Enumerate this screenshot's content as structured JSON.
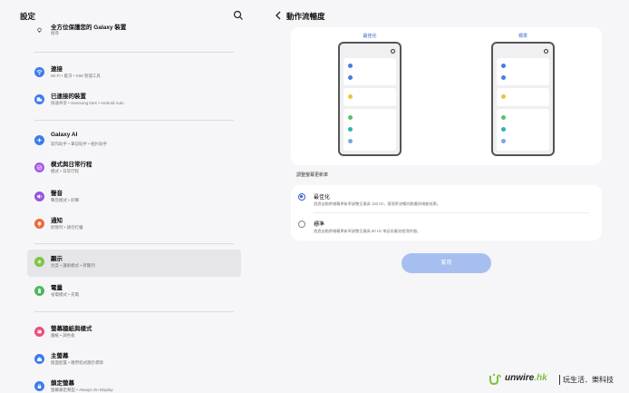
{
  "left_pane": {
    "title": "設定",
    "items": [
      {
        "key": "find-device",
        "title": "全方位保護您的 Galaxy 裝置",
        "subtitle": "搜尋",
        "icon": "lightbulb-icon",
        "color": ""
      },
      {
        "key": "connections",
        "title": "連接",
        "subtitle": "Wi-Fi • 藍牙 • SIM 管理工具",
        "icon": "wifi-icon",
        "color": "#3d7cf0"
      },
      {
        "key": "connected-devices",
        "title": "已連接的裝置",
        "subtitle": "快速共享 • Samsung DeX • Android Auto",
        "icon": "devices-icon",
        "color": "#3d7cf0"
      },
      {
        "key": "galaxy-ai",
        "title": "Galaxy AI",
        "subtitle": "寫作助手 • 筆記助手 • 相片助手",
        "icon": "sparkle-icon",
        "color": "#3d7cf0"
      },
      {
        "key": "modes-routines",
        "title": "模式與日常行程",
        "subtitle": "模式 • 日常行程",
        "icon": "check-circle-icon",
        "color": "#a65de8"
      },
      {
        "key": "sounds",
        "title": "聲音",
        "subtitle": "聲音模式 • 鈴聲",
        "icon": "speaker-icon",
        "color": "#9a55e0"
      },
      {
        "key": "notifications",
        "title": "通知",
        "subtitle": "狀態列 • 請勿打擾",
        "icon": "bell-icon",
        "color": "#f06a3a"
      },
      {
        "key": "display",
        "title": "顯示",
        "subtitle": "亮度 • 護眼模式 • 導覽列",
        "icon": "sun-icon",
        "color": "#7cc43c"
      },
      {
        "key": "battery",
        "title": "電量",
        "subtitle": "省電模式 • 充電",
        "icon": "battery-icon",
        "color": "#4cb860"
      },
      {
        "key": "wallpaper",
        "title": "螢幕牆紙與樣式",
        "subtitle": "牆紙 • 調色板",
        "icon": "palette-icon",
        "color": "#ec4e7a"
      },
      {
        "key": "home-screen",
        "title": "主螢幕",
        "subtitle": "版面配置 • 應用程式圖示標章",
        "icon": "home-icon",
        "color": "#3d7cf0"
      },
      {
        "key": "lock-screen",
        "title": "鎖定螢幕",
        "subtitle": "螢幕鎖定類型 • Always On Display",
        "icon": "lock-icon",
        "color": "#3d7cf0"
      }
    ]
  },
  "right_pane": {
    "title": "動作流暢度",
    "preview": {
      "left_label": "最佳化",
      "right_label": "標準",
      "dot_colors": [
        "#4a7be0",
        "#4a7be0",
        "#f0c23a",
        "#5cbf6a",
        "#2db5a8",
        "#7aa5e8"
      ]
    },
    "section_label": "調整螢幕更新率",
    "options": [
      {
        "title": "最佳化",
        "desc": "透過自動將螢幕更新率調整至最高 120 Hz，實現更流暢的動畫與捲動效果。",
        "selected": true
      },
      {
        "title": "標準",
        "desc": "透過自動將螢幕更新率調整至最高 60 Hz 來延長電池使用時間。",
        "selected": false
      }
    ],
    "apply_label": "套用"
  },
  "watermark": {
    "brand_main": "unwire",
    "brand_suffix": ".hk",
    "tagline": "玩生活．樂科技",
    "accent_color": "#7ec23a"
  }
}
